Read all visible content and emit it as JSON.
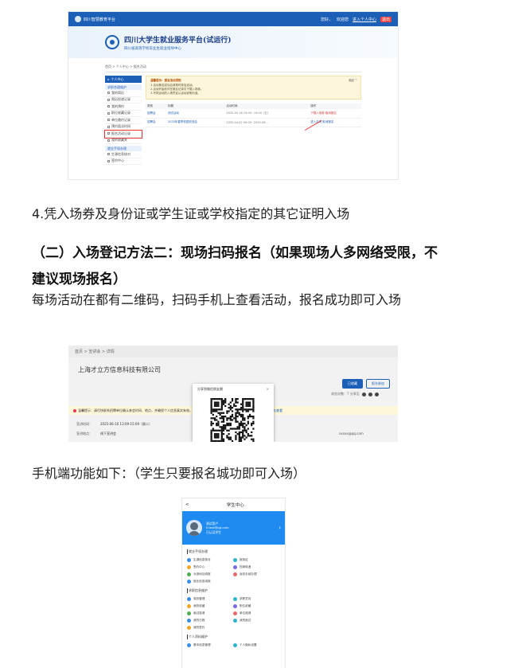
{
  "portal": {
    "top_left": "四川智慧教育平台",
    "top_right": [
      "您好，",
      "欢迎您",
      "进入个人中心",
      "退出"
    ],
    "title": "四川大学生就业服务平台(试运行)",
    "subtitle": "四川省高等学校毕业生就业指导中心",
    "breadcrumb": "首页 > 个人中心 > 报名活动",
    "sidebar_head": "个人中心",
    "sidebar_group1": "求职合理维护",
    "sidebar_items": [
      "我的简历",
      "简历投递记录",
      "我的预约",
      "职位收藏记录",
      "单位邀约记录",
      "预约面试时间",
      "报名活动记录",
      "我的收藏夹"
    ],
    "sidebar_group2": "就业手续办理",
    "sidebar_items2": [
      "生源信息核对",
      "签约中心"
    ],
    "notice_title": "温馨提示：报名活动须知",
    "notice_lines": [
      "1.活动报名成功后请按时参加活动。",
      "2.活动开始前可在报名记录中下载入场券。",
      "3.不同活动的入场凭证以活动说明为准。"
    ],
    "notice_more": "收起 ^",
    "table_headers": [
      "类别",
      "标题",
      "活动时间",
      "操作"
    ],
    "rows": [
      {
        "type": "招聘会",
        "title": "测试活动",
        "time": "2025-05-16 13:00~15:00（五）",
        "op": "下载入场券 取消报名"
      },
      {
        "type": "招聘会",
        "title": "2025年春季校园双选会",
        "time": "2025-04-02 09:00~2025-06...",
        "op": "进入会场 取消报名"
      }
    ]
  },
  "text": {
    "step4": "4.凭入场券及身份证或学生证或学校指定的其它证明入场",
    "heading": "（二）入场登记方法二：现场扫码报名（如果现场人多网络受限，不建议现场报名）",
    "para": "每场活动在都有二维码，扫码手机上查看活动，报名成功即可入场",
    "mobile_intro": "手机端功能如下：（学生只要报名城功即可入场）"
  },
  "activity": {
    "breadcrumb": "首页 > 宣讲会 > 详情",
    "company": "上海才立方信息科技有限公司",
    "btn_primary": "已收藏",
    "btn_secondary": "报名参加",
    "meta": "浏览次数：7  分享至",
    "warn": "温馨提示：请尽快联系招聘单位确认参会时间、地点，并确保个人信息真实有效，如有疑问请联系学校就业部门。",
    "warn_link": "点击查看",
    "time_label": "宣讲时间：",
    "time_value": "2025-06-16 13:09-15:09（周二）",
    "place_label": "宣讲地点：",
    "place_value": "线下宣讲会",
    "email": "xxxxx@qq.com",
    "modal_title": "分享到微信朋友圈",
    "modal_close": "×"
  },
  "mobile": {
    "back": "<",
    "title": "学生中心",
    "name": "测试用户",
    "email": "ll.test@qq.com",
    "status": "已认证学生",
    "section1": "就业手续办理",
    "section1_items": [
      "生源信息核对",
      "报到证",
      "签约中心",
      "档案转递",
      "派遣地址填报",
      "返校手续办理",
      "就业信息填报",
      ""
    ],
    "section2": "求职信息维护",
    "section2_items": [
      "简历管理",
      "求职意向",
      "我的收藏",
      "职位收藏",
      "面试邀请",
      "单位邀请",
      "我的日程",
      "我的面试",
      "我的签约",
      ""
    ],
    "section3": "个人资料维护",
    "section3_items": [
      "基本信息管理",
      "个人隐私设置"
    ],
    "dot_colors": [
      "#3a8ee6",
      "#2fb5c9",
      "#f5a623",
      "#7b6be0",
      "#4caf50",
      "#e86a6a"
    ]
  }
}
